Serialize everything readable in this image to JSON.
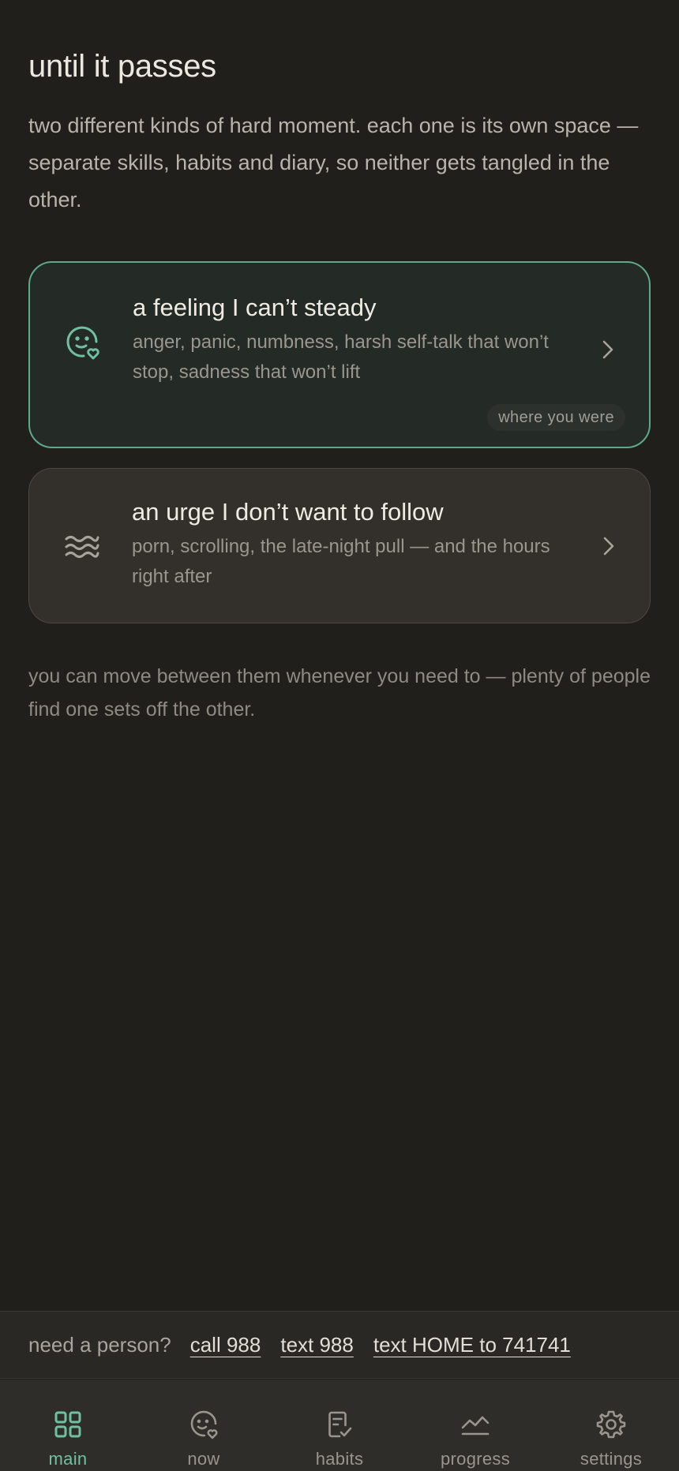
{
  "header": {
    "title": "until it passes",
    "intro": "two different kinds of hard moment. each one is its own space — separate skills, habits and diary, so neither gets tangled in the other."
  },
  "cards": [
    {
      "title": "a feeling I can’t steady",
      "description": "anger, panic, numbness, harsh self-talk that won’t stop, sadness that won’t lift",
      "badge": "where you were",
      "icon": "face-heart-icon"
    },
    {
      "title": "an urge I don’t want to follow",
      "description": "porn, scrolling, the late-night pull — and the hours right after",
      "icon": "waves-icon"
    }
  ],
  "footnote": "you can move between them whenever you need to — plenty of people find one sets off the other.",
  "help": {
    "label": "need a person?",
    "links": [
      "call 988",
      "text 988",
      "text HOME to 741741"
    ]
  },
  "nav": {
    "items": [
      {
        "label": "main",
        "icon": "grid-icon",
        "active": true
      },
      {
        "label": "now",
        "icon": "face-heart-icon",
        "active": false
      },
      {
        "label": "habits",
        "icon": "checklist-icon",
        "active": false
      },
      {
        "label": "progress",
        "icon": "trend-icon",
        "active": false
      },
      {
        "label": "settings",
        "icon": "gear-icon",
        "active": false
      }
    ]
  },
  "colors": {
    "background": "#201f1c",
    "accent": "#6fc1a0",
    "card_active_border": "#5fa98a"
  }
}
